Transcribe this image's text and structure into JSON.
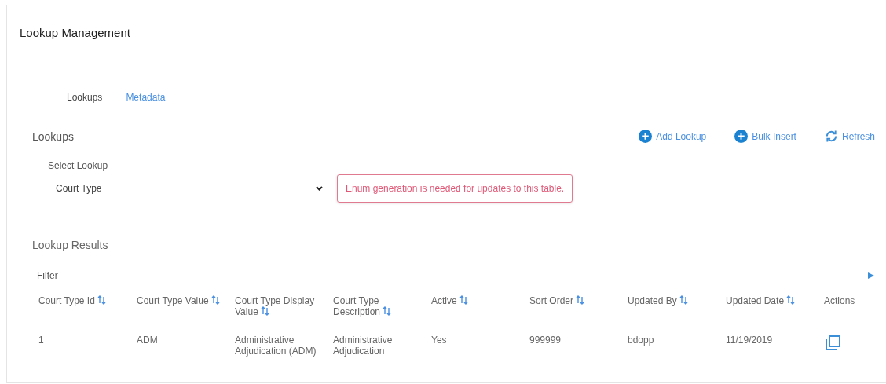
{
  "page": {
    "title": "Lookup Management"
  },
  "tabs": [
    {
      "label": "Lookups",
      "selected": true
    },
    {
      "label": "Metadata",
      "selected": false
    }
  ],
  "section": {
    "title": "Lookups",
    "actions": [
      {
        "kind": "add",
        "label": "Add Lookup"
      },
      {
        "kind": "add",
        "label": "Bulk Insert"
      },
      {
        "kind": "refresh",
        "label": "Refresh"
      }
    ]
  },
  "select_lookup": {
    "label": "Select Lookup",
    "value": "Court Type"
  },
  "alert": {
    "message": "Enum generation is needed for updates to this table."
  },
  "results": {
    "title": "Lookup Results",
    "filter": {
      "placeholder": "Filter"
    },
    "columns": [
      {
        "label": "Court Type Id",
        "sortable": true
      },
      {
        "label": "Court Type Value",
        "sortable": true
      },
      {
        "label": "Court Type Display Value",
        "sortable": true
      },
      {
        "label": "Court Type Description",
        "sortable": true
      },
      {
        "label": "Active",
        "sortable": true
      },
      {
        "label": "Sort Order",
        "sortable": true
      },
      {
        "label": "Updated By",
        "sortable": true
      },
      {
        "label": "Updated Date",
        "sortable": true
      },
      {
        "label": "Actions",
        "sortable": false
      }
    ],
    "rows": [
      {
        "cells": [
          "1",
          "ADM",
          "Administrative Adjudication (ADM)",
          "Administrative Adjudication",
          "Yes",
          "999999",
          "bdopp",
          "11/19/2019"
        ]
      }
    ]
  }
}
